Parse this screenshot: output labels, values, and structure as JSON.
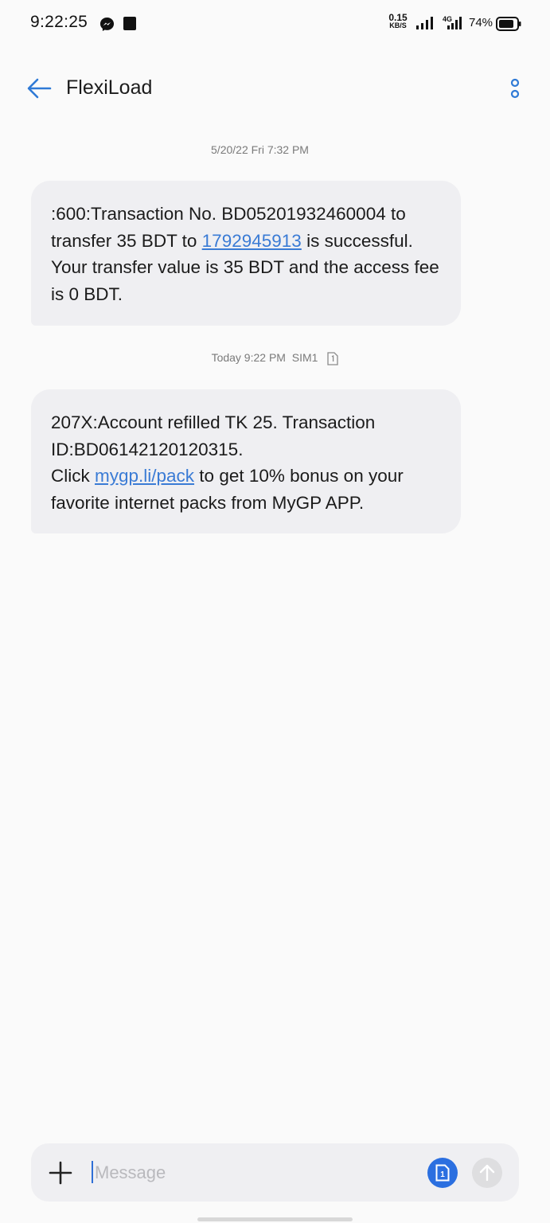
{
  "status_bar": {
    "time": "9:22:25",
    "net_speed_value": "0.15",
    "net_speed_unit": "KB/S",
    "network_type": "4G",
    "battery": "74%"
  },
  "header": {
    "title": "FlexiLoad"
  },
  "messages": [
    {
      "timestamp": "5/20/22 Fri 7:32 PM",
      "text_before_link": ":600:Transaction No. BD05201932460004 to transfer 35 BDT to ",
      "link": "1792945913",
      "text_after_link": " is successful. Your transfer value is 35 BDT and the access fee is 0 BDT."
    },
    {
      "timestamp": "Today 9:22 PM",
      "sim": "SIM1",
      "line1": "207X:Account refilled TK 25. Transaction ID:BD06142120120315.",
      "text_before_link": "Click ",
      "link": "mygp.li/pack",
      "text_after_link": " to get 10% bonus on your favorite internet packs from MyGP APP."
    }
  ],
  "compose": {
    "placeholder": "Message",
    "sim_number": "1"
  },
  "colors": {
    "accent": "#2b6fe0",
    "link": "#3a7bd5",
    "bubble": "#efeff2",
    "background": "#fafafa"
  },
  "icons": [
    "messenger-icon",
    "signal-icon",
    "battery-icon",
    "back-arrow-icon",
    "more-options-icon",
    "sim-icon",
    "plus-icon",
    "send-icon"
  ]
}
